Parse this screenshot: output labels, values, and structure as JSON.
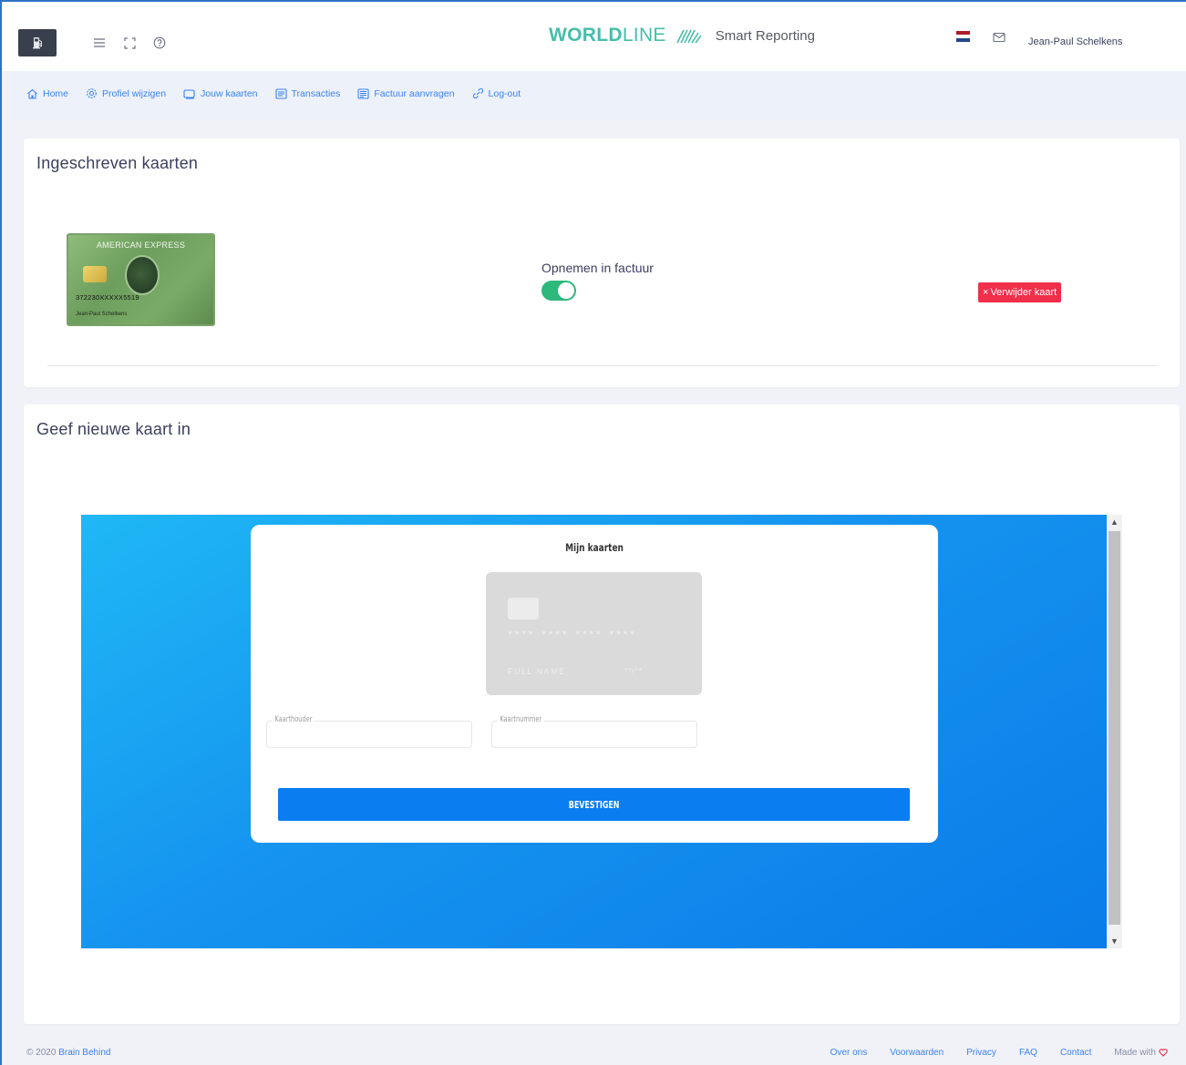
{
  "header": {
    "brand_bold": "WORLD",
    "brand_light": "LINE",
    "brand_sub": "Smart Reporting",
    "user_name": "Jean-Paul Schelkens",
    "flag_colors": [
      "#ae1c28",
      "#ffffff",
      "#21468b"
    ],
    "icons": [
      "menu-icon",
      "fullscreen-icon",
      "help-icon",
      "mail-icon"
    ]
  },
  "nav": {
    "items": [
      {
        "label": "Home",
        "icon": "home-icon"
      },
      {
        "label": "Profiel wijzigen",
        "icon": "gear-icon"
      },
      {
        "label": "Jouw kaarten",
        "icon": "card-icon"
      },
      {
        "label": "Transacties",
        "icon": "list-icon"
      },
      {
        "label": "Factuur aanvragen",
        "icon": "invoice-icon"
      },
      {
        "label": "Log-out",
        "icon": "logout-icon"
      }
    ]
  },
  "registered": {
    "title": "Ingeschreven kaarten",
    "card": {
      "brand": "AMERICAN EXPRESS",
      "number": "372230XXXXX5519",
      "holder": "Jean-Paul Schelkens"
    },
    "toggle_label": "Opnemen in factuur",
    "toggle_on": true,
    "remove_label": "Verwijder kaart"
  },
  "new_card": {
    "title": "Geef nieuwe kaart in",
    "form_title": "Mijn kaarten",
    "placeholder_card": {
      "number": "**** **** **** ****",
      "name": "FULL NAME",
      "expiry": "**/**"
    },
    "holder_label": "Kaarthouder",
    "number_label": "Kaartnummer",
    "confirm_label": "BEVESTIGEN"
  },
  "footer": {
    "copyright_prefix": "© 2020",
    "copyright_link": "Brain Behind",
    "links": [
      "Over ons",
      "Voorwaarden",
      "Privacy",
      "FAQ",
      "Contact"
    ],
    "made_with": "Made with"
  },
  "colors": {
    "accent": "#3b82f6",
    "brand_green": "#46beaa",
    "toggle_on": "#2eb87c",
    "remove": "#f0304a",
    "confirm": "#0a7df0"
  }
}
